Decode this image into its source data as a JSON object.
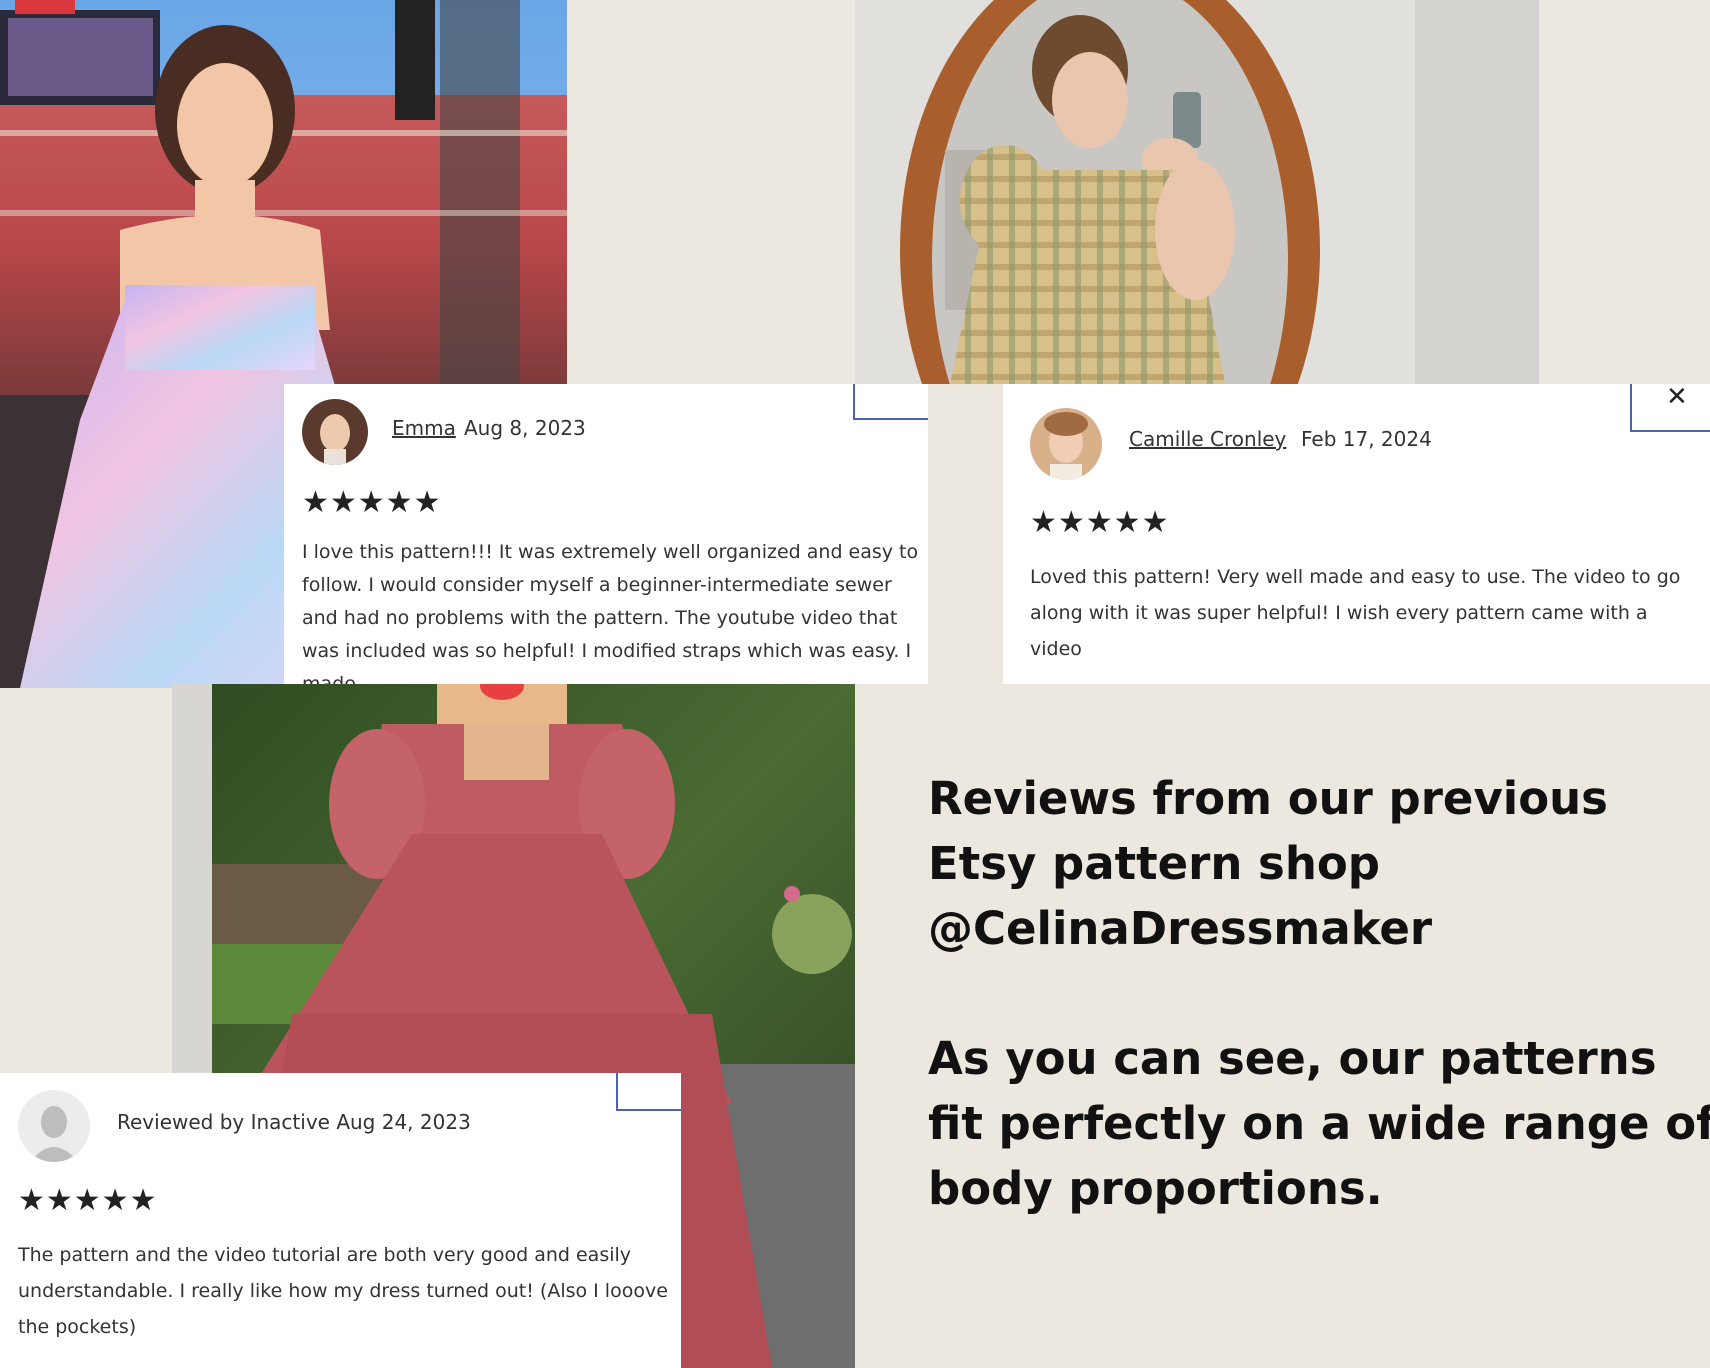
{
  "colors": {
    "background": "#ede8df",
    "card": "#ffffff",
    "accent_corner": "#4a63b5",
    "text": "#111111"
  },
  "reviews": [
    {
      "name": "Emma",
      "date": "Aug 8, 2023",
      "stars": "★★★★★",
      "text": "I love this pattern!!! It was extremely well organized and easy to follow. I would consider myself a beginner-intermediate sewer and had no problems with the pattern. The youtube video that was included was so helpful! I modified straps which was easy. I made"
    },
    {
      "name": "Camille Cronley",
      "date": "Feb 17, 2024",
      "stars": "★★★★★",
      "text": "Loved this pattern! Very well made and easy to use. The video to go along with it was super helpful! I wish every pattern came with a video"
    },
    {
      "by_line": "Reviewed by Inactive Aug 24, 2023",
      "stars": "★★★★★",
      "text": "The pattern and the video tutorial are both very good and easily understandable. I really like how my dress turned out! (Also I looove the pockets)"
    }
  ],
  "close_symbol": "✕",
  "caret_symbol": "^",
  "headline": {
    "line1": "Reviews from our previous",
    "line2": "Etsy pattern shop",
    "line3": "@CelinaDressmaker",
    "line4": "As you can see, our patterns",
    "line5": "fit perfectly on a wide range of",
    "line6": "body proportions."
  }
}
